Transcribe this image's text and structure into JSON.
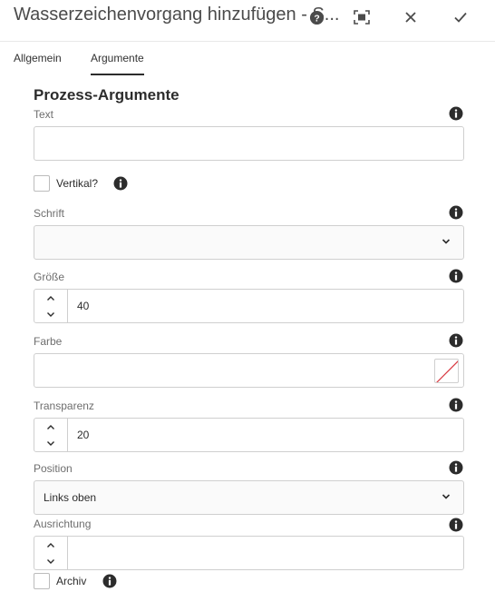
{
  "header": {
    "title": "Wasserzeichenvorgang hinzufügen - S...",
    "help_icon": "help-icon",
    "fullscreen_icon": "fullscreen-icon",
    "close_icon": "close-icon",
    "confirm_icon": "check-icon"
  },
  "tabs": [
    {
      "label": "Allgemein",
      "active": false
    },
    {
      "label": "Argumente",
      "active": true
    }
  ],
  "section": {
    "title": "Prozess-Argumente"
  },
  "fields": {
    "text": {
      "label": "Text",
      "value": ""
    },
    "vertikal": {
      "label": "Vertikal?",
      "checked": false
    },
    "schrift": {
      "label": "Schrift",
      "value": ""
    },
    "groesse": {
      "label": "Größe",
      "value": "40"
    },
    "farbe": {
      "label": "Farbe",
      "value": ""
    },
    "transparenz": {
      "label": "Transparenz",
      "value": "20"
    },
    "position": {
      "label": "Position",
      "value": "Links oben"
    },
    "ausrichtung": {
      "label": "Ausrichtung",
      "value": ""
    },
    "archiv": {
      "label": "Archiv",
      "checked": false
    }
  },
  "colors": {
    "swatch_slash": "#d7373f",
    "icon_dark": "#2c2c2c"
  }
}
